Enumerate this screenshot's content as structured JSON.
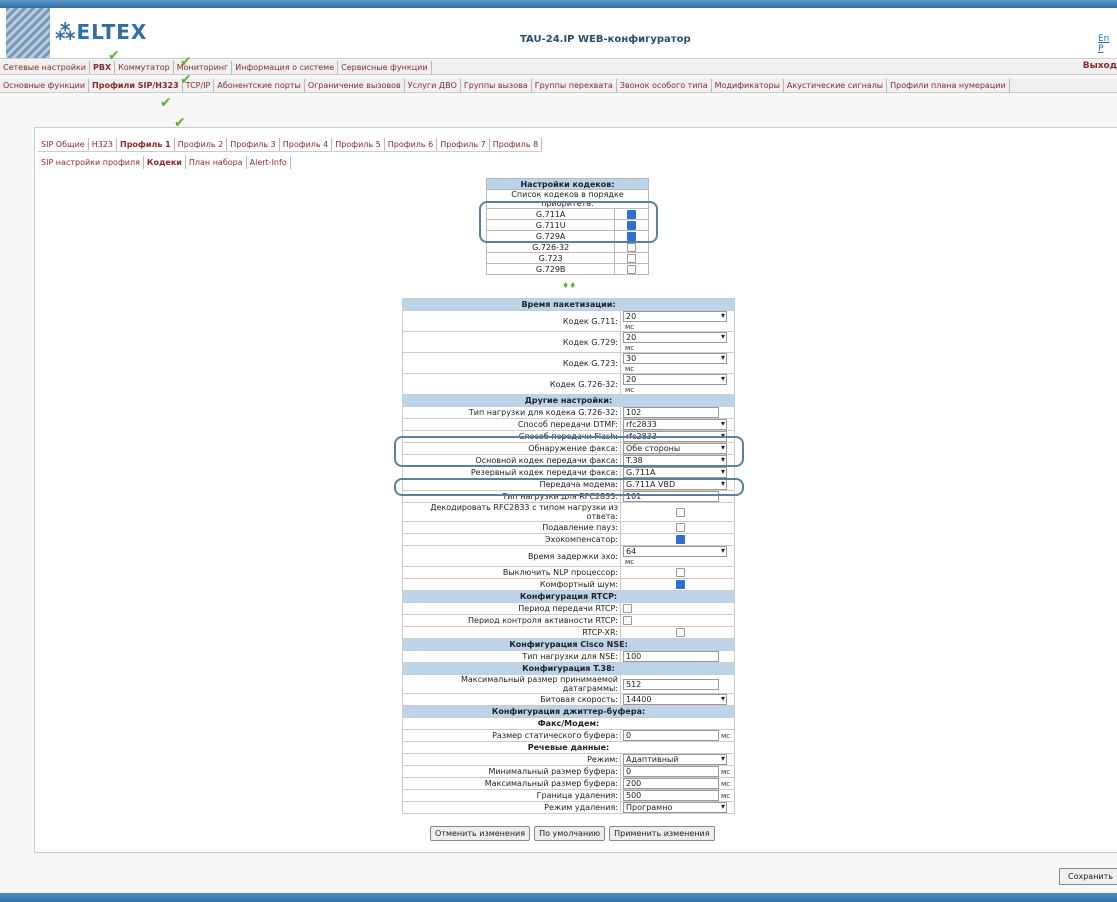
{
  "app": {
    "title": "TAU-24.IP WEB-конфигуратор",
    "logo": "ELTEX",
    "lang": "En P"
  },
  "menu1": {
    "items": [
      "Сетевые настройки",
      "PBX",
      "Коммутатор",
      "Мониторинг",
      "Информация о системе",
      "Сервисные функции"
    ],
    "exit": "Выход"
  },
  "menu2": {
    "items": [
      "Основные функции",
      "Профили SIP/H323",
      "TCP/IP",
      "Абонентские порты",
      "Ограничение вызовов",
      "Услуги ДВО",
      "Группы вызова",
      "Группы перехвата",
      "Звонок особого типа",
      "Модификаторы",
      "Акустические сигналы",
      "Профили плана нумерации"
    ]
  },
  "menu3": {
    "items": [
      "SIP Общие",
      "H323",
      "Профиль 1",
      "Профиль 2",
      "Профиль 3",
      "Профиль 4",
      "Профиль 5",
      "Профиль 6",
      "Профиль 7",
      "Профиль 8"
    ]
  },
  "menu4": {
    "items": [
      "SIP настройки профиля",
      "Кодеки",
      "План набора",
      "Alert-Info"
    ]
  },
  "codecs": {
    "title": "Настройки кодеков:",
    "subtitle": "Список кодеков в порядке приоритета:",
    "list": [
      {
        "name": "G.711A",
        "checked": true
      },
      {
        "name": "G.711U",
        "checked": true
      },
      {
        "name": "G.729A",
        "checked": true
      },
      {
        "name": "G.726-32",
        "checked": false
      },
      {
        "name": "G.723",
        "checked": false
      },
      {
        "name": "G.729B",
        "checked": false
      }
    ],
    "arrows": "♦♦"
  },
  "settings": {
    "h_packet": "Время пакетизации:",
    "g711_l": "Кодек G.711:",
    "g711_v": "20",
    "g729_l": "Кодек G.729:",
    "g729_v": "20",
    "g723_l": "Кодек G.723:",
    "g723_v": "30",
    "g726_l": "Кодек G.726-32:",
    "g726_v": "20",
    "unit_ms": "мс",
    "h_other": "Другие настройки:",
    "payload726_l": "Тип нагрузки для кодека G.726-32:",
    "payload726_v": "102",
    "dtmf_l": "Способ передачи DTMF:",
    "dtmf_v": "rfc2833",
    "flash_l": "Способ передачи Flash:",
    "flash_v": "rfc2833",
    "fax_detect_l": "Обнаружение факса:",
    "fax_detect_v": "Обе стороны",
    "fax_main_l": "Основной кодек передачи факса:",
    "fax_main_v": "T.38",
    "fax_backup_l": "Резервный кодек передачи факса:",
    "fax_backup_v": "G.711A",
    "modem_l": "Передача модема:",
    "modem_v": "G.711A VBD",
    "rfc2833_l": "Тип нагрузки для RFC2833:",
    "rfc2833_v": "101",
    "decode_l": "Декодировать RFC2833 с типом нагрузки из ответа:",
    "silence_l": "Подавление пауз:",
    "echo_l": "Эхокомпенсатор:",
    "echo_delay_l": "Время задержки эхо:",
    "echo_delay_v": "64",
    "nlp_l": "Выключить NLP процессор:",
    "comfort_l": "Комфортный шум:",
    "h_rtcp": "Конфигурация RTCP:",
    "rtcp_period_l": "Период передачи RTCP:",
    "rtcp_ctrl_l": "Период контроля активности RTCP:",
    "rtcpxr_l": "RTCP-XR:",
    "h_nse": "Конфигурация Cisco NSE:",
    "nse_l": "Тип нагрузки для NSE:",
    "nse_v": "100",
    "h_t38": "Конфигурация T.38:",
    "t38max_l": "Максимальный размер принимаемой датаграммы:",
    "t38max_v": "512",
    "bitrate_l": "Битовая скорость:",
    "bitrate_v": "14400",
    "h_jitter": "Конфигурация джиттер-буфера:",
    "h_fax": "Факс/Модем:",
    "static_l": "Размер статического буфера:",
    "static_v": "0",
    "h_voice": "Речевые данные:",
    "mode_l": "Режим:",
    "mode_v": "Адаптивный",
    "minbuf_l": "Минимальный размер буфера:",
    "minbuf_v": "0",
    "maxbuf_l": "Максимальный размер буфера:",
    "maxbuf_v": "200",
    "delborder_l": "Граница удаления:",
    "delborder_v": "500",
    "delmode_l": "Режим удаления:",
    "delmode_v": "Програмно"
  },
  "buttons": {
    "cancel": "Отменить изменения",
    "default": "По умолчанию",
    "apply": "Применить изменения",
    "save": "Сохранить"
  }
}
